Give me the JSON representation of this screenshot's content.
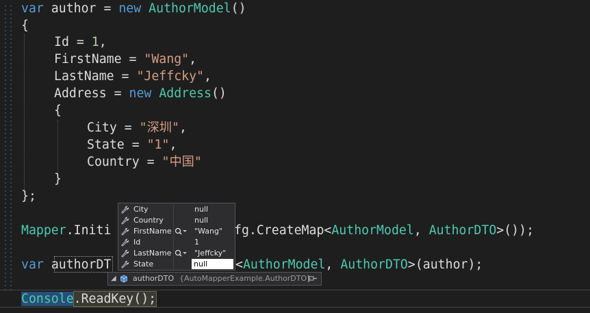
{
  "code": {
    "line1": {
      "kw": "var",
      "ident": " author = ",
      "kw2": "new",
      "type": "AuthorModel",
      "tail": "()"
    },
    "line2": "{",
    "line3": {
      "prop": "Id = ",
      "num": "1",
      "tail": ","
    },
    "line4": {
      "prop": "FirstName = ",
      "str": "\"Wang\"",
      "tail": ","
    },
    "line5": {
      "prop": "LastName = ",
      "str": "\"Jeffcky\"",
      "tail": ","
    },
    "line6": {
      "prop": "Address = ",
      "kw": "new",
      "type": "Address",
      "tail": "()"
    },
    "line7": "{",
    "line8": {
      "prop": "City = ",
      "str": "\"深圳\"",
      "tail": ","
    },
    "line9": {
      "prop": "State = ",
      "str": "\"1\"",
      "tail": ","
    },
    "line10": {
      "prop": "Country = ",
      "str": "\"中国\""
    },
    "line11": "}",
    "line12": "};",
    "line13": {
      "type": "Mapper",
      "a": ".Initi",
      "b": "fg.CreateMap<",
      "t1": "AuthorModel",
      "c": ", ",
      "t2": "AuthorDTO",
      "d": ">());"
    },
    "line14": {
      "kw": "var",
      "a": " ",
      "ident": "authorDT",
      "b": "<",
      "t1": "AuthorModel",
      "c": ", ",
      "t2": "AuthorDTO",
      "d": ">(author);"
    },
    "line15": {
      "type": "Console",
      "method": ".ReadKey();"
    }
  },
  "datatip": {
    "rows": [
      {
        "name": "City",
        "value": "null",
        "has_viewer": false
      },
      {
        "name": "Country",
        "value": "null",
        "has_viewer": false
      },
      {
        "name": "FirstName",
        "value": "\"Wang\"",
        "has_viewer": true
      },
      {
        "name": "Id",
        "value": "1",
        "has_viewer": false
      },
      {
        "name": "LastName",
        "value": "\"Jeffcky\"",
        "has_viewer": true
      },
      {
        "name": "State",
        "value": "null",
        "has_viewer": false,
        "editing": true
      }
    ],
    "footer": {
      "expand": "◢",
      "name": "authorDTO",
      "type": "{AutoMapperExample.AuthorDTO}"
    }
  },
  "colors": {
    "keyword": "#569cd6",
    "type": "#4ec9b0",
    "string": "#d69d85",
    "number": "#b5cea8",
    "background": "#1e1e1e"
  }
}
